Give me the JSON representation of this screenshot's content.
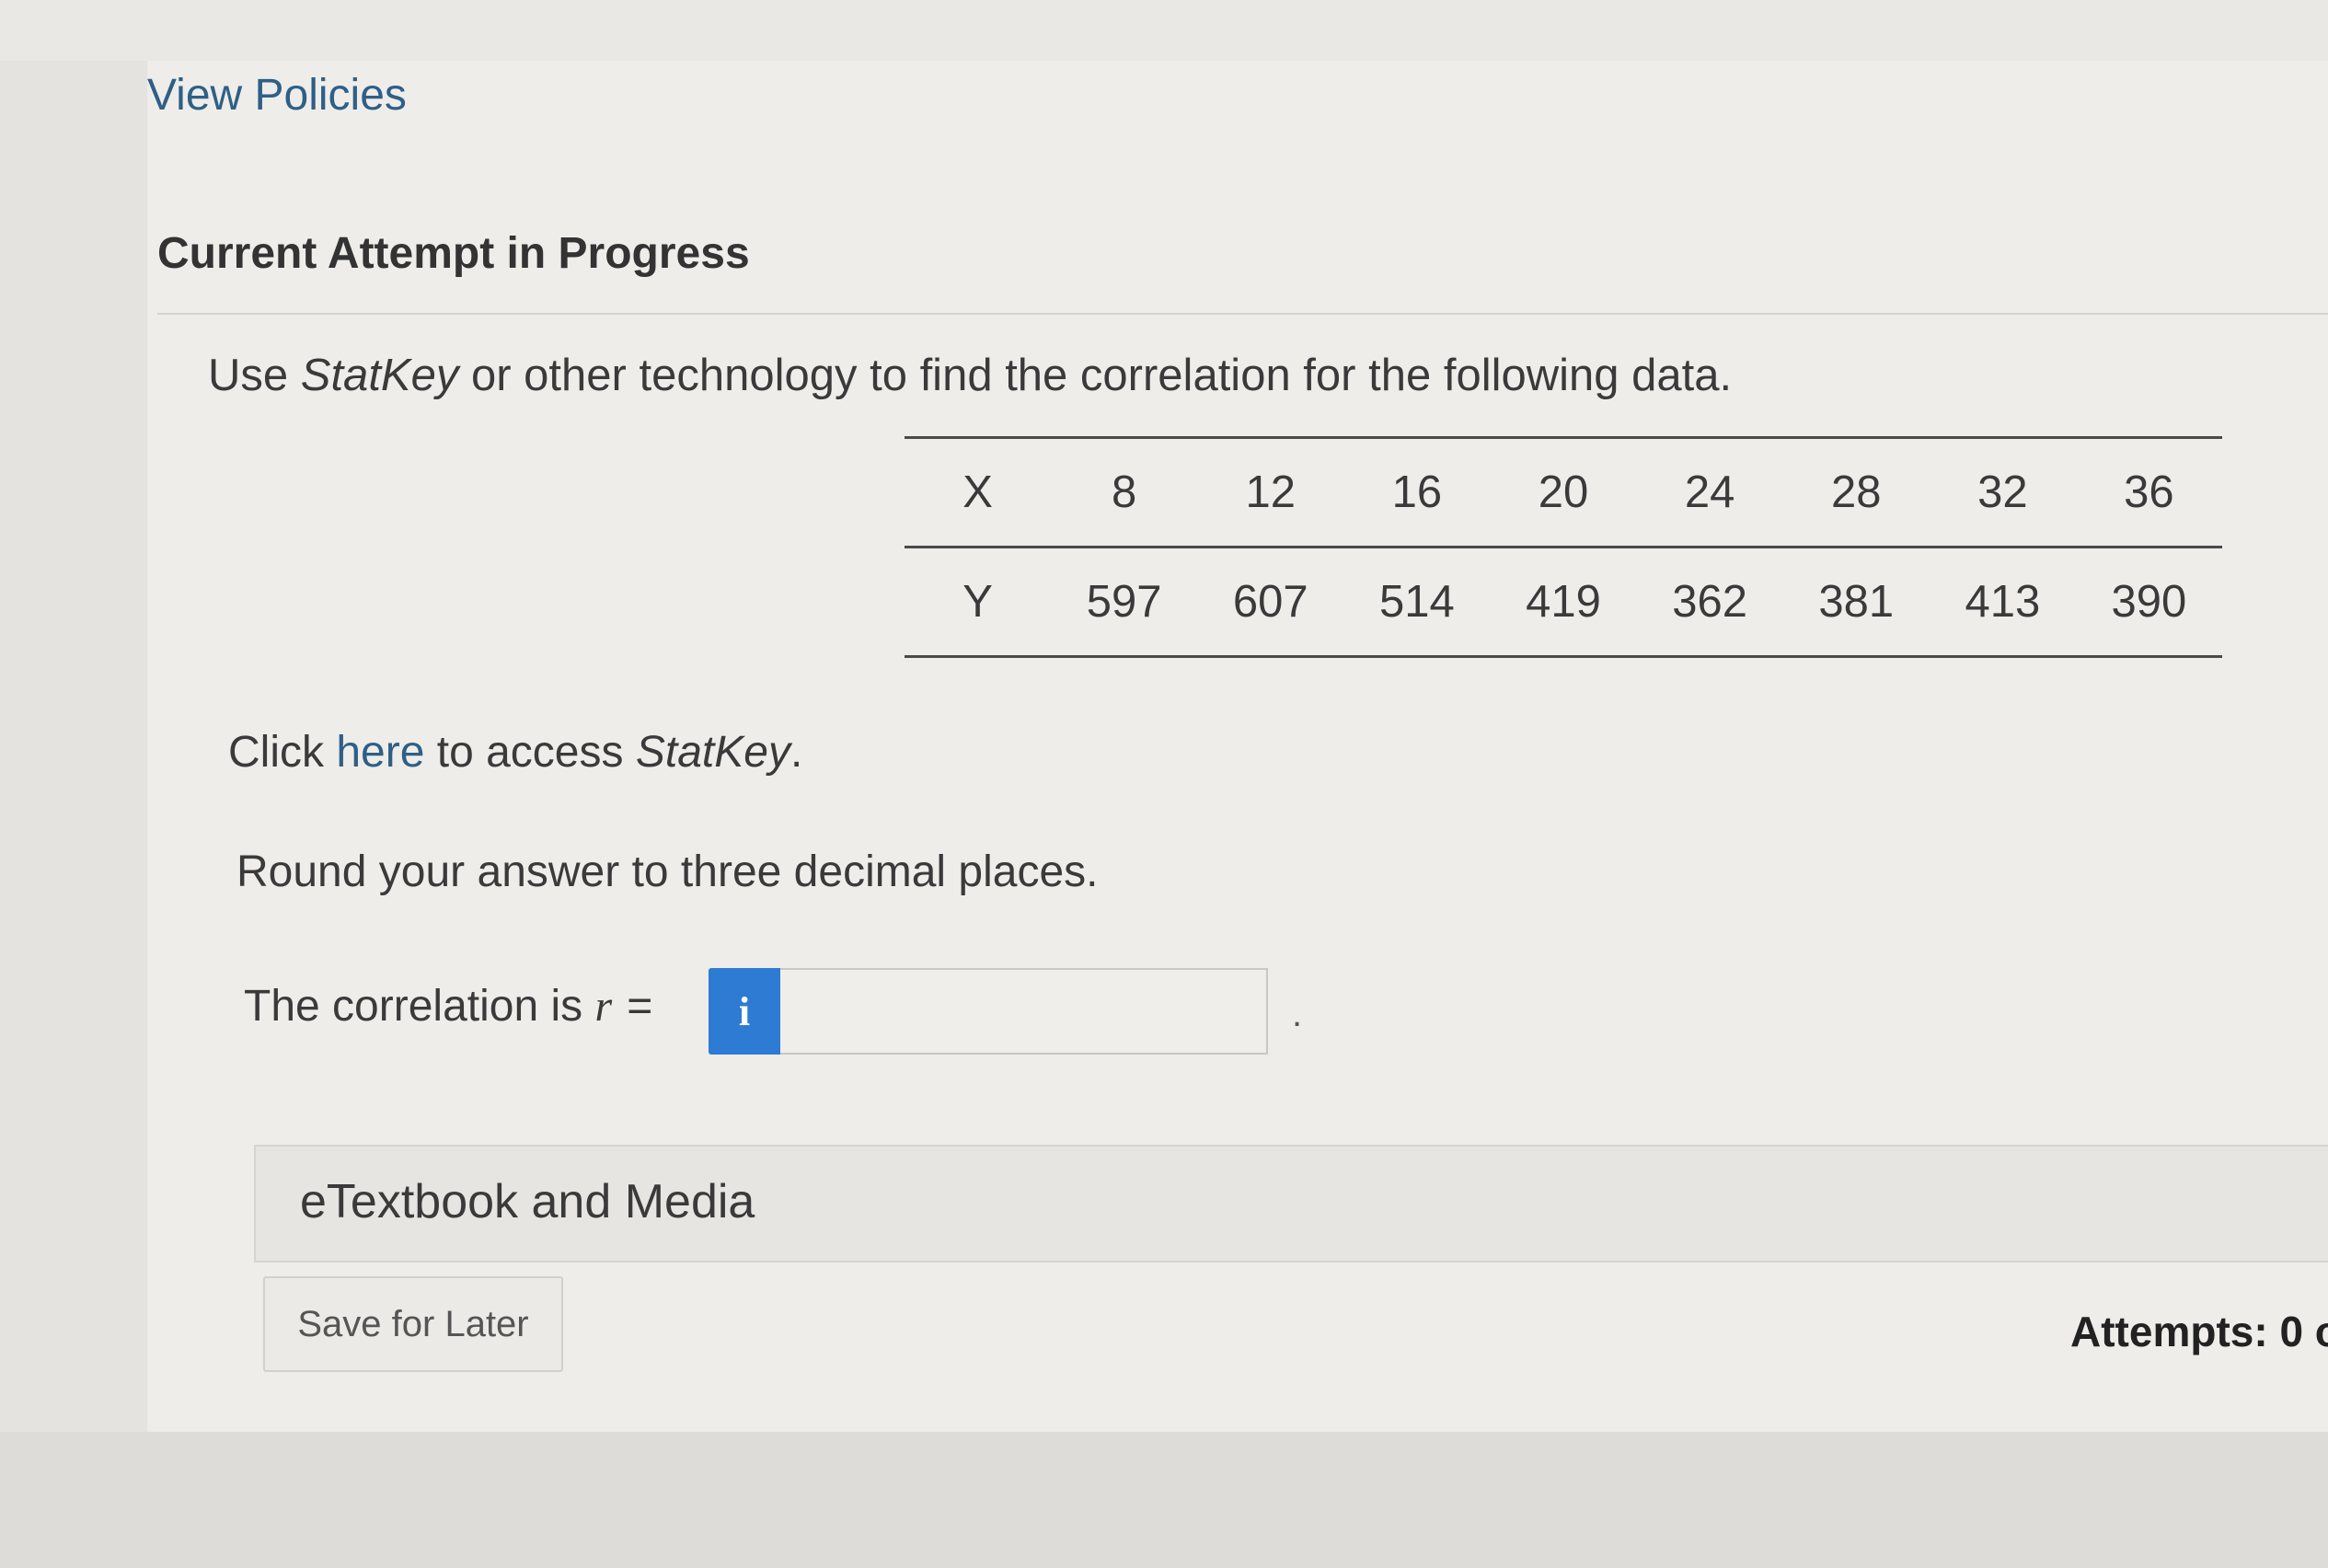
{
  "header": {
    "view_policies": "View Policies"
  },
  "attempt": {
    "title": "Current Attempt in Progress"
  },
  "question": {
    "prefix": "Use ",
    "statkey": "StatKey",
    "suffix": " or other technology to find the correlation for the following data."
  },
  "data_table": {
    "x_label": "X",
    "y_label": "Y",
    "x_values": [
      "8",
      "12",
      "16",
      "20",
      "24",
      "28",
      "32",
      "36"
    ],
    "y_values": [
      "597",
      "607",
      "514",
      "419",
      "362",
      "381",
      "413",
      "390"
    ]
  },
  "statkey_link": {
    "click": "Click ",
    "here": "here",
    "to_access": " to access ",
    "statkey": "StatKey",
    "period": "."
  },
  "instructions": {
    "round": "Round your answer to three decimal places."
  },
  "answer": {
    "label_prefix": "The correlation is ",
    "r_symbol": "r",
    "equals": "=",
    "info_icon": "i",
    "value": "",
    "period": "."
  },
  "etextbook": {
    "label": "eTextbook and Media"
  },
  "footer": {
    "save_label": "Save for Later",
    "attempts": "Attempts: 0 o"
  }
}
